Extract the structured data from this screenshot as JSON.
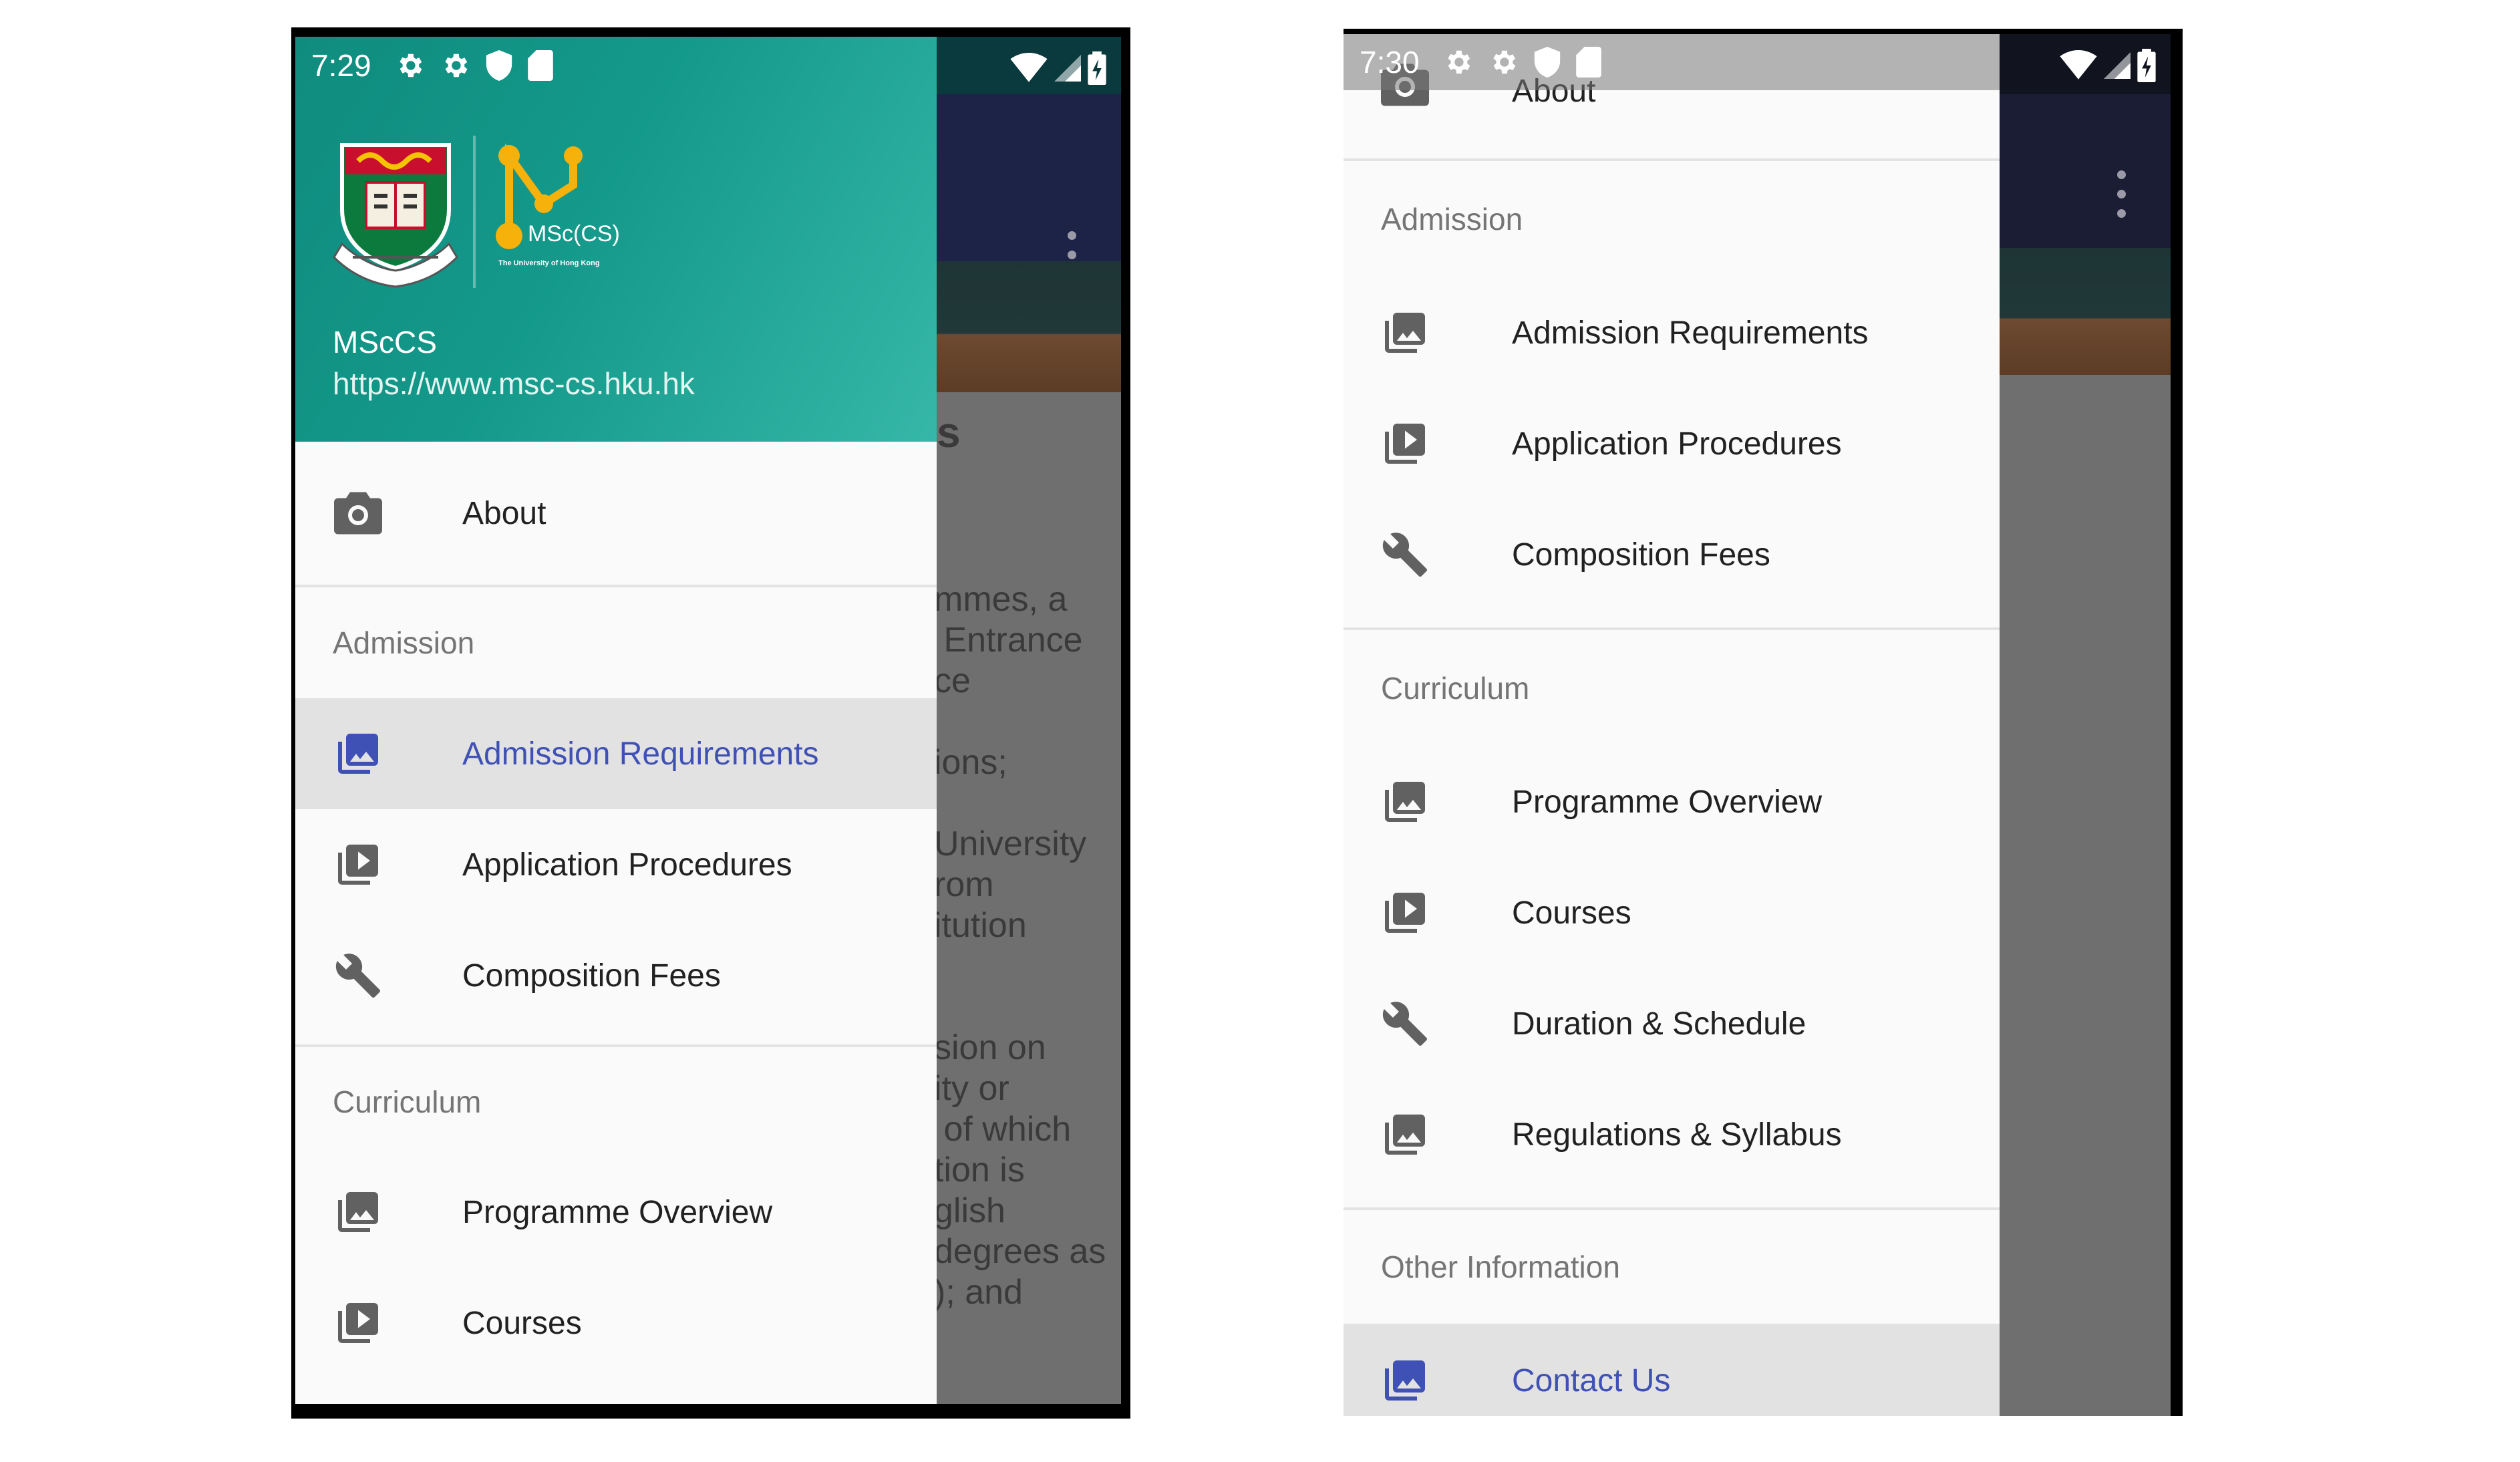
{
  "left_screen": {
    "status": {
      "time": "7:29"
    },
    "background": {
      "partial_heading": "s",
      "partial_text": "mmes, a\n Entrance\nce\n\nions;\n\nUniversity\nrom\nitution\n\n\nsion on\nity or\n of which\ntion is\nglish\ndegrees as\n); and"
    },
    "header": {
      "title": "MScCS",
      "url": "https://www.msc-cs.hku.hk",
      "logo_text": "MSc(CS)",
      "logo_subtext": "The University of Hong Kong"
    },
    "items": {
      "about": "About",
      "admission_section": "Admission",
      "admission_requirements": "Admission Requirements",
      "application_procedures": "Application Procedures",
      "composition_fees": "Composition Fees",
      "curriculum_section": "Curriculum",
      "programme_overview": "Programme Overview",
      "courses": "Courses"
    },
    "active_item": "Admission Requirements"
  },
  "right_screen": {
    "status": {
      "time": "7:30"
    },
    "items": {
      "about": "About",
      "admission_section": "Admission",
      "admission_requirements": "Admission Requirements",
      "application_procedures": "Application Procedures",
      "composition_fees": "Composition Fees",
      "curriculum_section": "Curriculum",
      "programme_overview": "Programme Overview",
      "courses": "Courses",
      "duration_schedule": "Duration & Schedule",
      "regulations_syllabus": "Regulations & Syllabus",
      "other_section": "Other Information",
      "contact_us": "Contact Us"
    },
    "active_item": "Contact Us"
  },
  "colors": {
    "header_teal": "#14998a",
    "active_blue": "#3f51b5",
    "icon_grey": "#616161"
  }
}
